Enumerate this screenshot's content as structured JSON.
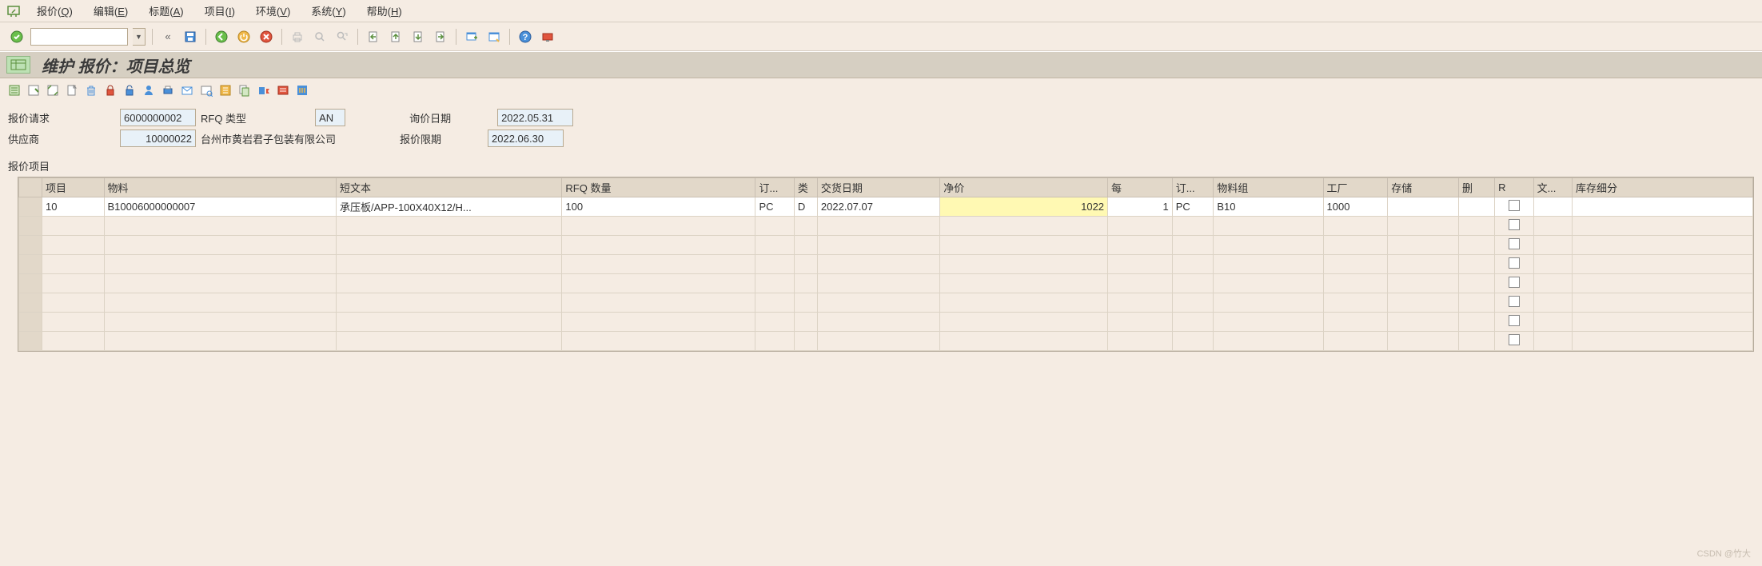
{
  "menu": {
    "items": [
      {
        "label": "报价",
        "key": "Q"
      },
      {
        "label": "编辑",
        "key": "E"
      },
      {
        "label": "标题",
        "key": "A"
      },
      {
        "label": "项目",
        "key": "I"
      },
      {
        "label": "环境",
        "key": "V"
      },
      {
        "label": "系统",
        "key": "Y"
      },
      {
        "label": "帮助",
        "key": "H"
      }
    ]
  },
  "toolbar": {
    "command_value": ""
  },
  "title": "维护 报价：项目总览",
  "header": {
    "rfq_request_label": "报价请求",
    "rfq_request_value": "6000000002",
    "rfq_type_label": "RFQ 类型",
    "rfq_type_value": "AN",
    "inquiry_date_label": "询价日期",
    "inquiry_date_value": "2022.05.31",
    "vendor_label": "供应商",
    "vendor_code": "10000022",
    "vendor_name": "台州市黄岩君子包装有限公司",
    "quote_deadline_label": "报价限期",
    "quote_deadline_value": "2022.06.30"
  },
  "section_label": "报价项目",
  "columns": {
    "item": "项目",
    "material": "物料",
    "short_text": "短文本",
    "rfq_qty": "RFQ 数量",
    "order_unit": "订...",
    "cat": "类",
    "delivery_date": "交货日期",
    "net_price": "净价",
    "per": "每",
    "order_pu": "订...",
    "material_group": "物料组",
    "plant": "工厂",
    "storage": "存储",
    "delete": "删",
    "r": "R",
    "text": "文...",
    "stock_seg": "库存细分"
  },
  "rows": [
    {
      "item": "10",
      "material": "B10006000000007",
      "short_text": "承压板/APP-100X40X12/H...",
      "rfq_qty": "100",
      "order_unit": "PC",
      "cat": "D",
      "delivery_date": "2022.07.07",
      "net_price": "1022",
      "per": "1",
      "order_pu": "PC",
      "material_group": "B10",
      "plant": "1000",
      "storage": "",
      "delete": "",
      "r_checked": false,
      "text": "",
      "stock_seg": ""
    }
  ],
  "watermark": "CSDN @竹大"
}
